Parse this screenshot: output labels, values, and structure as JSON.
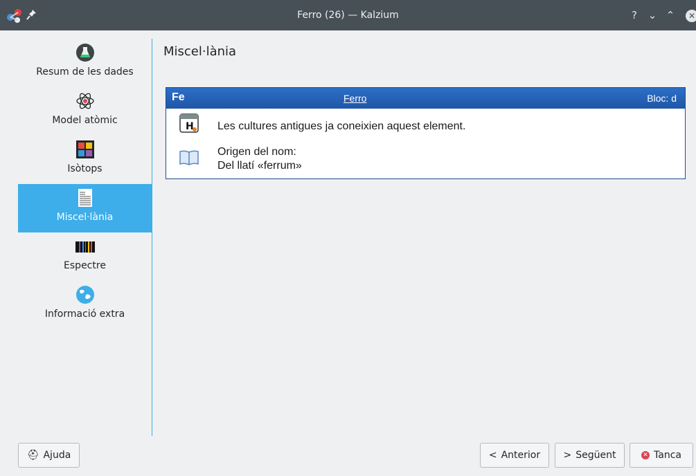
{
  "window": {
    "title": "Ferro (26) — Kalzium"
  },
  "titlebar": {
    "help": "?",
    "minimize": "⌄",
    "maximize": "⌃",
    "close": "✕"
  },
  "sidebar": {
    "items": [
      {
        "label": "Resum de les dades",
        "icon": "flask-icon"
      },
      {
        "label": "Model atòmic",
        "icon": "atom-icon"
      },
      {
        "label": "Isòtops",
        "icon": "isotope-table-icon"
      },
      {
        "label": "Miscel·lània",
        "icon": "document-icon",
        "active": true
      },
      {
        "label": "Espectre",
        "icon": "spectrum-icon"
      },
      {
        "label": "Informació extra",
        "icon": "globe-icon"
      }
    ]
  },
  "main": {
    "title": "Miscel·lània",
    "panel": {
      "symbol": "Fe",
      "name": "Ferro",
      "block": "Bloc: d",
      "fact": "Les cultures antigues ja coneixien aquest element.",
      "origin_label": "Origen del nom:",
      "origin_value": "Del llatí «ferrum»"
    }
  },
  "footer": {
    "help": "Ajuda",
    "previous": "Anterior",
    "next": "Següent",
    "close": "Tanca",
    "prev_glyph": "<",
    "next_glyph": ">",
    "close_glyph": "✕",
    "help_glyph": "⛑"
  },
  "colors": {
    "accent": "#3daee9",
    "titlebar": "#475057",
    "panel_header": "#2d6ec7",
    "close_red": "#da4453"
  }
}
